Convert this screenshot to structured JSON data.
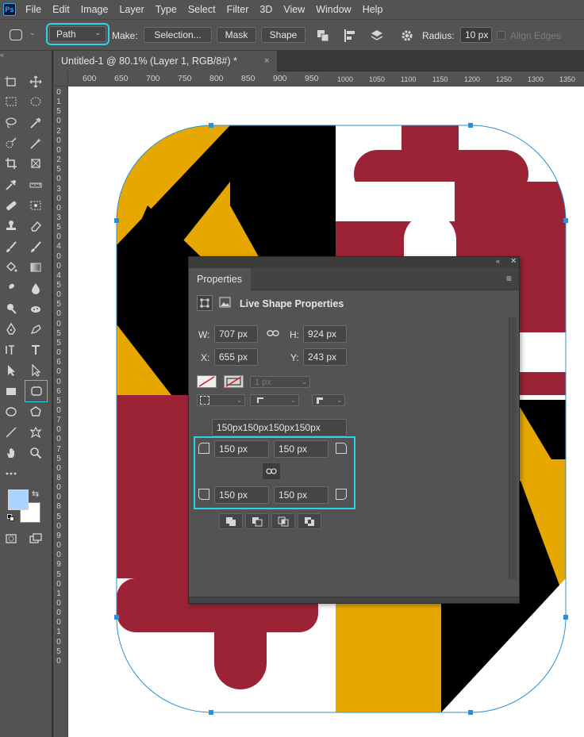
{
  "app": {
    "logo": "Ps"
  },
  "menu": [
    "File",
    "Edit",
    "Image",
    "Layer",
    "Type",
    "Select",
    "Filter",
    "3D",
    "View",
    "Window",
    "Help"
  ],
  "options_bar": {
    "mode_value": "Path",
    "make_label": "Make:",
    "selection_button": "Selection...",
    "mask_button": "Mask",
    "shape_button": "Shape",
    "radius_label": "Radius:",
    "radius_value": "10 px",
    "align_edges_label": "Align Edges"
  },
  "document_tab": {
    "title": "Untitled-1 @ 80.1% (Layer 1, RGB/8#) *",
    "close": "×"
  },
  "ruler": {
    "horizontal": [
      "600",
      "650",
      "700",
      "750",
      "800",
      "850",
      "900",
      "950",
      "1000",
      "1050",
      "1100",
      "1150",
      "1200",
      "1250",
      "1300",
      "1350"
    ],
    "vertical": [
      "0",
      "1",
      "5",
      "0",
      "2",
      "0",
      "0",
      "2",
      "5",
      "0",
      "3",
      "0",
      "0",
      "3",
      "5",
      "0",
      "4",
      "0",
      "0",
      "4",
      "5",
      "0",
      "5",
      "0",
      "0",
      "5",
      "5",
      "0",
      "6",
      "0",
      "0",
      "6",
      "5",
      "0",
      "7",
      "0",
      "0",
      "7",
      "5",
      "0",
      "8",
      "0",
      "0",
      "8",
      "5",
      "0",
      "9",
      "0",
      "0",
      "9",
      "5",
      "0",
      "1",
      "0",
      "0",
      "0",
      "1",
      "0",
      "5",
      "0"
    ]
  },
  "colors": {
    "flag_red": "#9b2335",
    "flag_gold": "#e6a800",
    "flag_black": "#000000",
    "selection_blue": "#2a8fd6",
    "highlight_cyan": "#2ad4e4",
    "foreground_swatch": "#aad4ff",
    "background_swatch": "#ffffff"
  },
  "properties": {
    "tab_label": "Properties",
    "section_title": "Live Shape Properties",
    "w_label": "W:",
    "w_value": "707 px",
    "h_label": "H:",
    "h_value": "924 px",
    "x_label": "X:",
    "x_value": "655 px",
    "y_label": "Y:",
    "y_value": "243 px",
    "stroke_width": "1 px",
    "radius_summary": "150px150px150px150px",
    "corner_tl": "150 px",
    "corner_tr": "150 px",
    "corner_bl": "150 px",
    "corner_br": "150 px"
  },
  "icons": [
    "rectangle-tool-icon",
    "move-tool-icon",
    "marquee-icon",
    "lasso-icon",
    "eyedropper-icon",
    "crop-icon",
    "brush-icon",
    "stamp-icon",
    "eraser-icon",
    "bucket-icon",
    "pen-icon",
    "type-icon",
    "path-select-icon",
    "rounded-rectangle-icon",
    "ellipse-icon",
    "hand-icon",
    "zoom-icon",
    "gear-icon",
    "link-icon"
  ]
}
